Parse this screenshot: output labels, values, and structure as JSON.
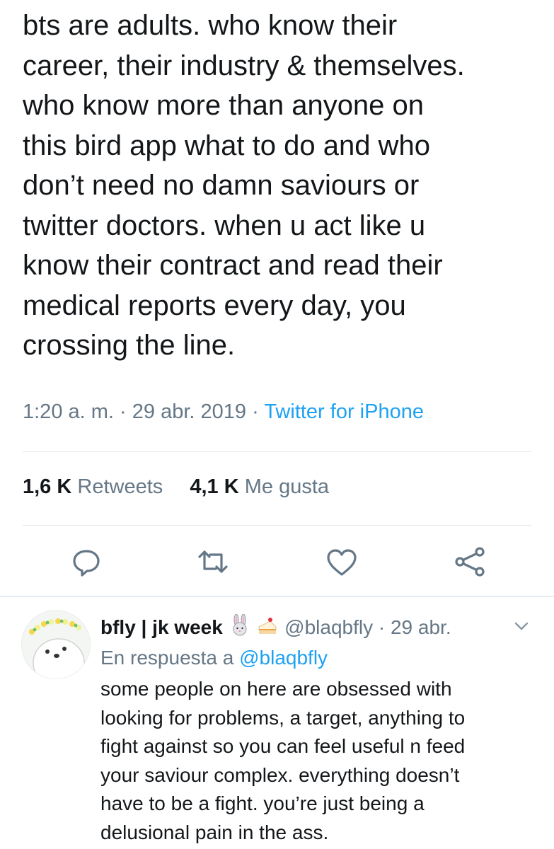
{
  "tweet": {
    "lines": [
      "bts are adults. who know their",
      "career, their industry & themselves.",
      "who know more than anyone on",
      "this bird app what to do and who",
      "don’t need no damn saviours or",
      "twitter doctors. when u act like u",
      "know their contract and read their",
      "medical reports every day, you",
      "crossing the line."
    ],
    "time": "1:20 a. m.",
    "sep": "·",
    "date": "29 abr. 2019",
    "source": "Twitter for iPhone",
    "retweets_count": "1,6 K",
    "retweets_label": "Retweets",
    "likes_count": "4,1 K",
    "likes_label": "Me gusta"
  },
  "actions": [
    "reply-icon",
    "retweet-icon",
    "like-icon",
    "share-icon"
  ],
  "reply": {
    "name": "bfly | jk week",
    "emojis": [
      "rabbit-emoji",
      "cake-emoji"
    ],
    "handle": "@blaqbfly",
    "sep": "·",
    "date": "29 abr.",
    "reply_prefix": "En respuesta a",
    "reply_handle": "@blaqbfly",
    "lines": [
      "some people on here are obsessed with",
      "looking for problems, a target, anything to",
      "fight against so you can feel useful n feed",
      "your saviour complex. everything doesn’t",
      "have to be a fight. you’re just being a",
      "delusional pain in the ass."
    ]
  },
  "colors": {
    "text": "#14171a",
    "secondary": "#657786",
    "link": "#1da1f2",
    "divider": "#e1e8ed"
  }
}
